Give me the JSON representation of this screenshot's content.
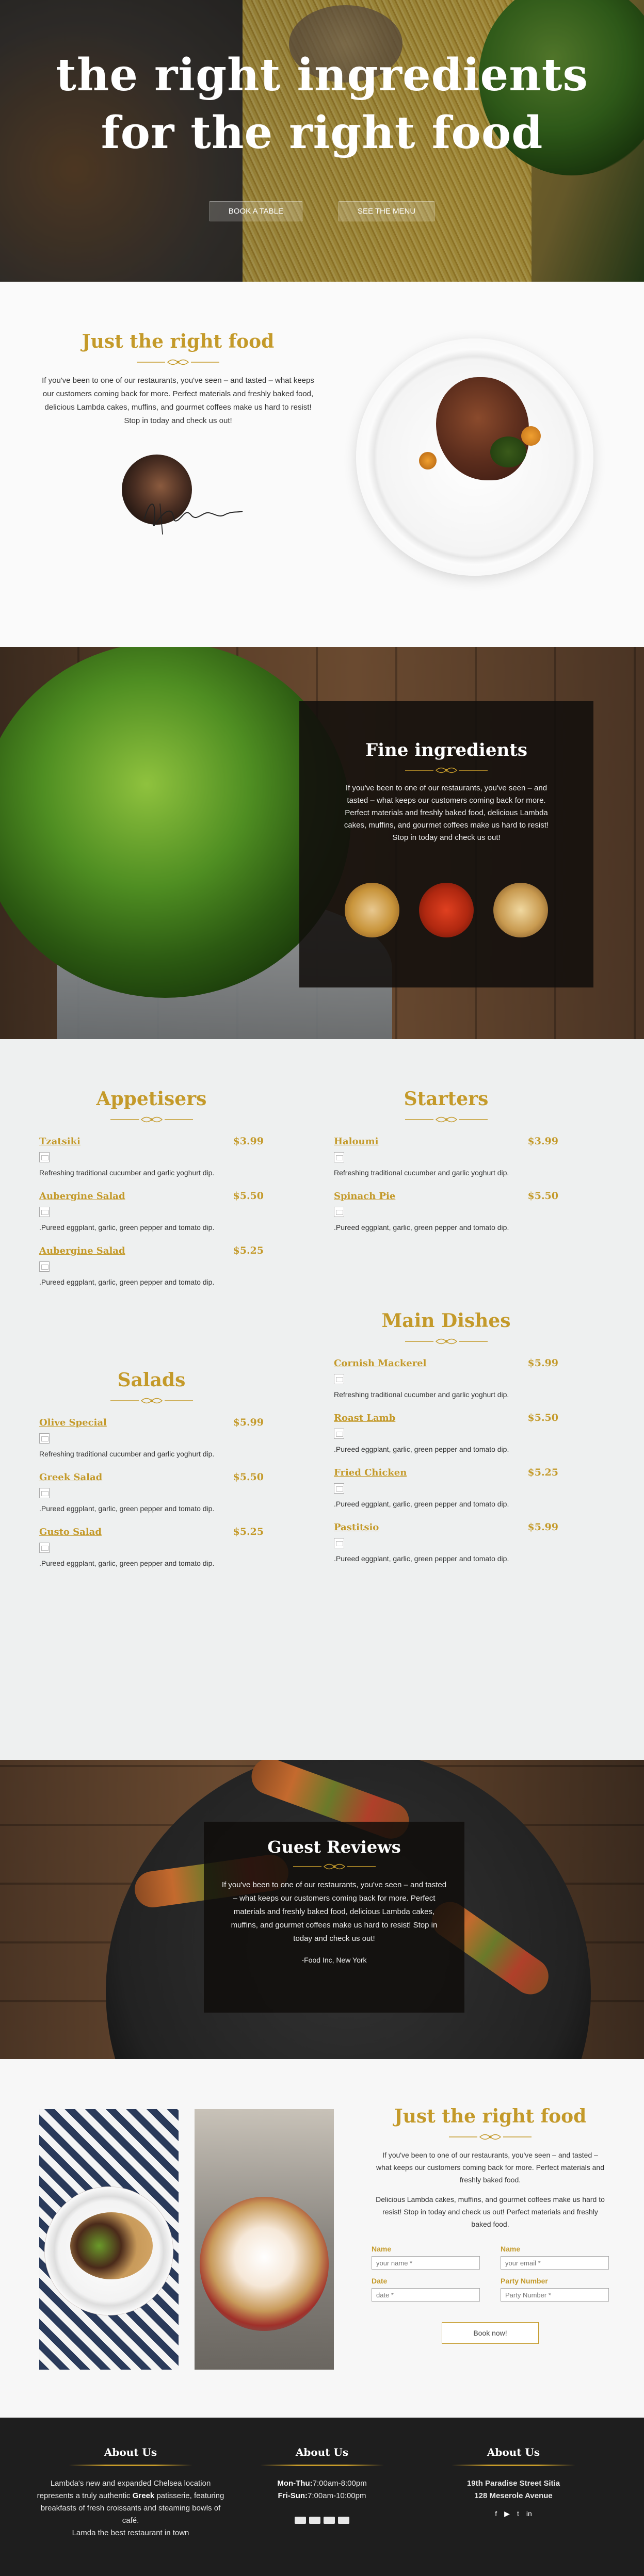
{
  "hero": {
    "title_line1": "the right ingredients",
    "title_line2": "for the right food",
    "btn_book": "BOOK A TABLE",
    "btn_menu": "SEE THE MENU"
  },
  "intro": {
    "title": "Just the right food",
    "text": "If you've been to one of our restaurants, you've seen – and tasted – what keeps our customers coming back for more. Perfect materials and freshly baked food, delicious Lambda cakes, muffins, and gourmet coffees make us hard to resist! Stop in today and check us out!"
  },
  "fine": {
    "title": "Fine ingredients",
    "text": "If you've been to one of our restaurants, you've seen – and tasted – what keeps our customers coming back for more. Perfect materials and freshly baked food, delicious Lambda cakes, muffins, and gourmet coffees make us hard to resist! Stop in today and check us out!"
  },
  "menu": {
    "appetisers": {
      "title": "Appetisers",
      "items": [
        {
          "name": "Tzatsiki",
          "price": "$3.99",
          "desc": "Refreshing traditional cucumber and garlic yoghurt dip."
        },
        {
          "name": "Aubergine Salad",
          "price": "$5.50",
          "desc": ".Pureed eggplant, garlic, green pepper and tomato dip."
        },
        {
          "name": "Aubergine Salad",
          "price": "$5.25",
          "desc": ".Pureed eggplant, garlic, green pepper and tomato dip."
        }
      ]
    },
    "salads": {
      "title": "Salads",
      "items": [
        {
          "name": "Olive Special",
          "price": "$5.99",
          "desc": "Refreshing traditional cucumber and garlic yoghurt dip."
        },
        {
          "name": "Greek Salad",
          "price": "$5.50",
          "desc": ".Pureed eggplant, garlic, green pepper and tomato dip."
        },
        {
          "name": "Gusto Salad",
          "price": "$5.25",
          "desc": ".Pureed eggplant, garlic, green pepper and tomato dip."
        }
      ]
    },
    "starters": {
      "title": "Starters",
      "items": [
        {
          "name": "Haloumi",
          "price": "$3.99",
          "desc": "Refreshing traditional cucumber and garlic yoghurt dip."
        },
        {
          "name": "Spinach Pie",
          "price": "$5.50",
          "desc": ".Pureed eggplant, garlic, green pepper and tomato dip."
        }
      ]
    },
    "mains": {
      "title": "Main Dishes",
      "items": [
        {
          "name": "Cornish Mackerel",
          "price": "$5.99",
          "desc": "Refreshing traditional cucumber and garlic yoghurt dip."
        },
        {
          "name": "Roast Lamb",
          "price": "$5.50",
          "desc": ".Pureed eggplant, garlic, green pepper and tomato dip."
        },
        {
          "name": "Fried Chicken",
          "price": "$5.25",
          "desc": ".Pureed eggplant, garlic, green pepper and tomato dip."
        },
        {
          "name": "Pastitsio",
          "price": "$5.99",
          "desc": ".Pureed eggplant, garlic, green pepper and tomato dip."
        }
      ]
    }
  },
  "reviews": {
    "title": "Guest Reviews",
    "text": "If you've been to one of our restaurants, you've seen – and tasted – what keeps our customers coming back for more. Perfect materials and freshly baked food, delicious Lambda cakes, muffins, and gourmet coffees make us hard to resist! Stop in today and check us out!",
    "author": "-Food Inc, New York"
  },
  "reservation": {
    "title": "Just the right food",
    "text1": "If you've been to one of our restaurants, you've seen – and tasted – what keeps our customers coming back for more. Perfect materials and freshly baked food.",
    "text2": "Delicious Lambda cakes, muffins, and gourmet coffees make us hard to resist! Stop in today and check us out! Perfect materials and freshly baked food.",
    "fields": {
      "name_label": "Name",
      "name_placeholder": "your name *",
      "name2_label": "Name",
      "email_placeholder": "your email *",
      "date_label": "Date",
      "date_placeholder": "date *",
      "party_label": "Party Number",
      "party_placeholder": "Party Number *"
    },
    "button": "Book now!"
  },
  "footer": {
    "col1": {
      "title": "About Us",
      "text_a": "Lambda's new and expanded Chelsea location represents a truly authentic ",
      "text_bold": "Greek",
      "text_b": " patisserie, featuring breakfasts of fresh croissants and steaming bowls of café.",
      "text_c": "Lamda the best restaurant in town"
    },
    "col2": {
      "title": "About Us",
      "day1": "Mon-Thu:",
      "hours1": "7:00am-8:00pm",
      "day2": "Fri-Sun:",
      "hours2": "7:00am-10:00pm"
    },
    "col3": {
      "title": "About Us",
      "address1": "19th Paradise Street Sitia",
      "address2": "128 Meserole Avenue"
    },
    "social": {
      "facebook": "f",
      "youtube": "▶",
      "twitter": "t",
      "linkedin": "in"
    }
  }
}
